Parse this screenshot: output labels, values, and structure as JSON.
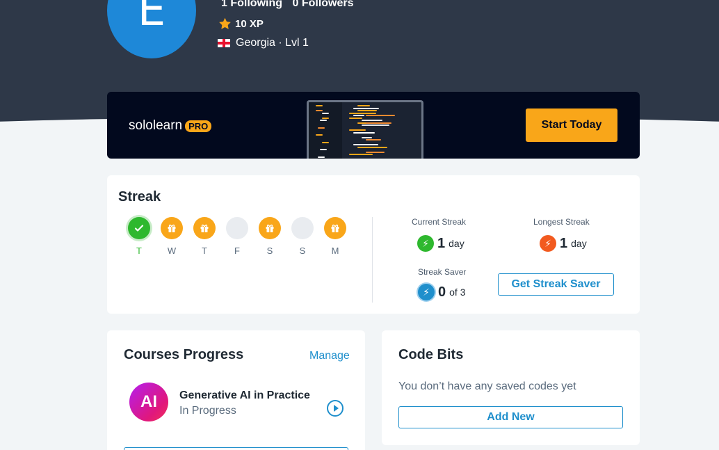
{
  "profile": {
    "avatar_letter": "E",
    "following_count": "1",
    "following_label": "Following",
    "followers_count": "0",
    "followers_label": "Followers",
    "xp": "10 XP",
    "country_level": "Georgia · Lvl 1"
  },
  "pro_banner": {
    "brand": "sololearn",
    "badge": "PRO",
    "cta": "Start Today",
    "accent": "#f9a619"
  },
  "streak": {
    "title": "Streak",
    "days": [
      {
        "label": "T",
        "state": "done"
      },
      {
        "label": "W",
        "state": "gift"
      },
      {
        "label": "T",
        "state": "gift"
      },
      {
        "label": "F",
        "state": "empty"
      },
      {
        "label": "S",
        "state": "gift"
      },
      {
        "label": "S",
        "state": "empty"
      },
      {
        "label": "M",
        "state": "gift"
      }
    ],
    "current_label": "Current Streak",
    "current_value": "1",
    "current_unit": "day",
    "longest_label": "Longest Streak",
    "longest_value": "1",
    "longest_unit": "day",
    "saver_label": "Streak Saver",
    "saver_value": "0",
    "saver_unit": "of 3",
    "saver_button": "Get Streak Saver"
  },
  "courses": {
    "title": "Courses Progress",
    "manage": "Manage",
    "items": [
      {
        "icon_text": "AI",
        "name": "Generative AI in Practice",
        "status": "In Progress"
      }
    ]
  },
  "code_bits": {
    "title": "Code Bits",
    "empty_text": "You don’t have any saved codes yet",
    "add_button": "Add New"
  }
}
